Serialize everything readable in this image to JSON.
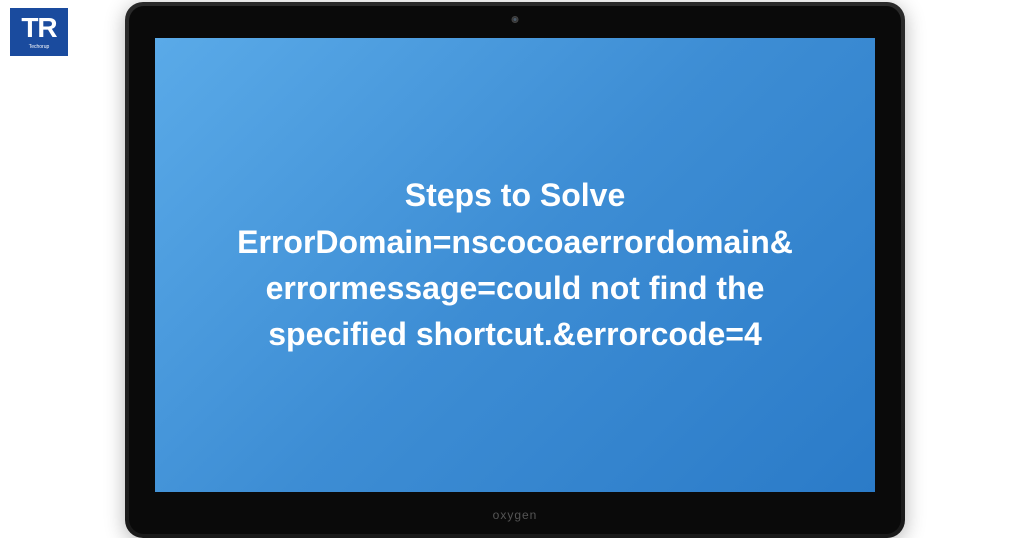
{
  "logo": {
    "text": "TR",
    "subtext": "Techorup"
  },
  "tablet": {
    "brand": "oxygen",
    "screen_text": "Steps to Solve ErrorDomain=nscocoaerrordomain&errormessage=could not find the specified shortcut.&errorcode=4"
  }
}
